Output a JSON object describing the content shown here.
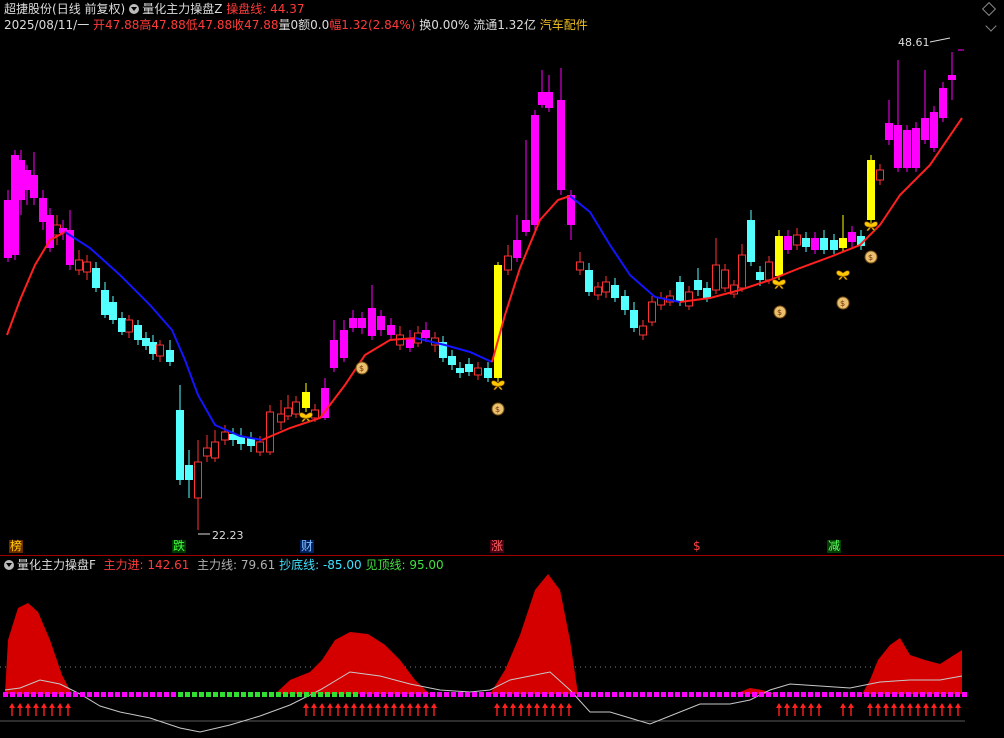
{
  "header": {
    "stock_name": "超捷股份",
    "period": "(日线 前复权)",
    "indicator_main": "量化主力操盘Z",
    "indicator_line": "操盘线: 44.37",
    "date": "2025/08/11/一",
    "open": "开47.88",
    "high": "高47.88",
    "low": "低47.88",
    "close": "收47.88",
    "volume": "量0",
    "amount": "额0.0",
    "change": "幅1.32(2.84%)",
    "turnover": "换0.00%",
    "float": "流通1.32亿",
    "sector": "汽车配件"
  },
  "price_labels": {
    "high": "48.61",
    "low": "22.23"
  },
  "signals": [
    {
      "label": "榜",
      "color": "#ffd000",
      "bg": "#6a2a00"
    },
    {
      "label": "跌",
      "color": "#40ff40",
      "bg": "#003800"
    },
    {
      "label": "财",
      "color": "#80c0ff",
      "bg": "#002060"
    },
    {
      "label": "涨",
      "color": "#ff6060",
      "bg": "#4a0010"
    },
    {
      "label": "$",
      "color": "#ff4040",
      "bg": "#000000"
    },
    {
      "label": "减",
      "color": "#60ff60",
      "bg": "#004000"
    }
  ],
  "sub": {
    "indicator": "量化主力操盘F",
    "inflow": "主力进: 142.61",
    "main_line": "主力线: 79.61",
    "bottom_line": "抄底线: -85.00",
    "top_line": "见顶线: 95.00"
  },
  "colors": {
    "up": "#ff3232",
    "down": "#54ffff",
    "pink": "#ff00ff",
    "yellow": "#ffff00",
    "ma_up": "#ff2020",
    "ma_down": "#1414ff",
    "area": "#d40000"
  }
}
